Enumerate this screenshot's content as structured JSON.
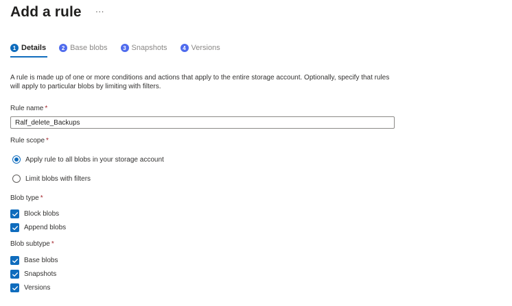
{
  "header": {
    "title": "Add a rule",
    "more_label": "···"
  },
  "tabs": [
    {
      "num": "1",
      "label": "Details"
    },
    {
      "num": "2",
      "label": "Base blobs"
    },
    {
      "num": "3",
      "label": "Snapshots"
    },
    {
      "num": "4",
      "label": "Versions"
    }
  ],
  "description": "A rule is made up of one or more conditions and actions that apply to the entire storage account. Optionally, specify that rules will apply to particular blobs by limiting with filters.",
  "rule_name": {
    "label": "Rule name",
    "value": "Ralf_delete_Backups"
  },
  "rule_scope": {
    "label": "Rule scope",
    "options": [
      {
        "label": "Apply rule to all blobs in your storage account",
        "selected": true
      },
      {
        "label": "Limit blobs with filters",
        "selected": false
      }
    ]
  },
  "blob_type": {
    "label": "Blob type",
    "options": [
      {
        "label": "Block blobs",
        "checked": true
      },
      {
        "label": "Append blobs",
        "checked": true
      }
    ]
  },
  "blob_subtype": {
    "label": "Blob subtype",
    "options": [
      {
        "label": "Base blobs",
        "checked": true
      },
      {
        "label": "Snapshots",
        "checked": true
      },
      {
        "label": "Versions",
        "checked": true
      }
    ]
  },
  "required_marker": "*",
  "colors": {
    "accent": "#0f6cbd",
    "required": "#a4262c"
  }
}
